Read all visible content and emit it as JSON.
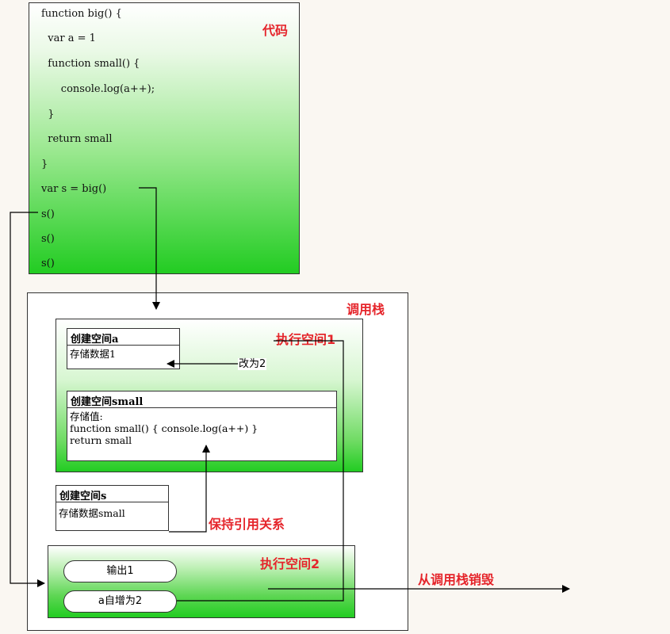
{
  "code": {
    "label": "代码",
    "lines": [
      "function big() {",
      "  var a = 1",
      "  function small() {",
      "      console.log(a++);",
      "  }",
      "  return small",
      "}",
      "var s = big()",
      "s()",
      "s()",
      "s()"
    ]
  },
  "call_stack": {
    "label": "调用栈",
    "exec_space_1": {
      "label": "执行空间1",
      "card_a": {
        "title": "创建空间a",
        "body": "存储数据1"
      },
      "card_small": {
        "title": "创建空间small",
        "body": "存储值:\nfunction small() { console.log(a++) }\nreturn small"
      }
    },
    "card_s": {
      "title": "创建空间s",
      "body": "存储数据small"
    },
    "keep_ref_label": "保持引用关系",
    "exec_space_2": {
      "label": "执行空间2",
      "output_pill": "输出1",
      "increment_pill": "a自增为2"
    }
  },
  "change_label": "改为2",
  "destroy_label": "从调用栈销毁",
  "colors": {
    "accent_red": "#e5252b",
    "green": "#22cc22"
  }
}
